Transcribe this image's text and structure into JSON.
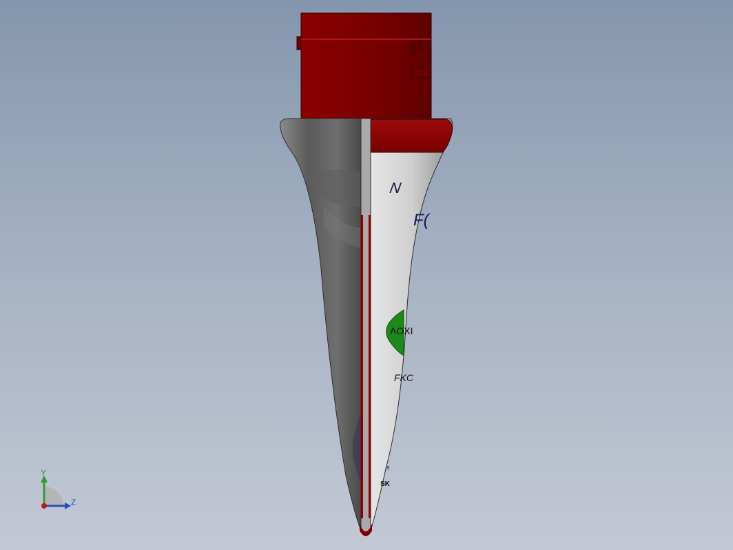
{
  "viewport": {
    "background_top": "#8496ad",
    "background_bottom": "#c3c8d4"
  },
  "model": {
    "colors": {
      "red_part": "#7a0000",
      "red_highlight": "#a30f0f",
      "grey_body": "#9a9a9a",
      "green_label": "#1b8a1b"
    },
    "decal_text": {
      "line1": "N",
      "line2": "F(",
      "green_badge": "AOXI",
      "line3": "FKC",
      "line4": "s",
      "line5": "SK"
    }
  },
  "triad": {
    "y_label": "Y",
    "z_label": "Z",
    "y_color": "#2f9a2f",
    "z_color": "#2b4fb8",
    "origin_color": "#b81c1c"
  }
}
